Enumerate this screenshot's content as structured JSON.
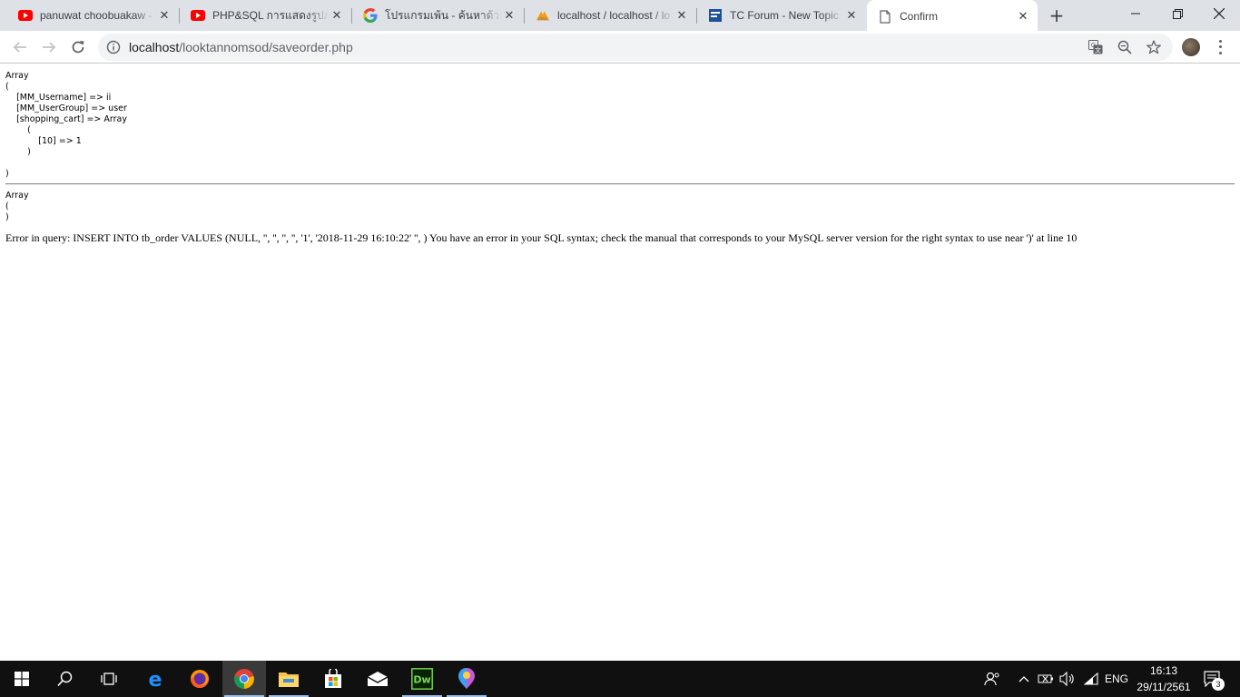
{
  "browser": {
    "tabs": [
      {
        "title": "panuwat choobuakaw - YouTube",
        "favicon": "youtube-icon"
      },
      {
        "title": "PHP&SQL การแสดงรูปภาพ",
        "favicon": "youtube-icon"
      },
      {
        "title": "โปรแกรมเพ้น - ค้นหาด้วย Google",
        "favicon": "google-icon"
      },
      {
        "title": "localhost / localhost / lo",
        "favicon": "phpmyadmin-icon"
      },
      {
        "title": "TC Forum - New Topic",
        "favicon": "forum-icon"
      },
      {
        "title": "Confirm",
        "favicon": "page-icon",
        "active": true
      }
    ],
    "url": {
      "host": "localhost",
      "path": "/looktannomsod/saveorder.php"
    }
  },
  "page": {
    "dump1": "Array\n(\n    [MM_Username] => ii\n    [MM_UserGroup] => user\n    [shopping_cart] => Array\n        (\n            [10] => 1\n        )\n\n)",
    "dump2": "Array\n(\n)",
    "error_message": "Error in query: INSERT INTO tb_order VALUES (NULL, '', '', '', '', '1', '2018-11-29 16:10:22' '', ) You have an error in your SQL syntax; check the manual that corresponds to your MySQL server version for the right syntax to use near ')' at line 10"
  },
  "taskbar": {
    "lang": "ENG",
    "time": "16:13",
    "date": "29/11/2561",
    "notifications": "3"
  }
}
